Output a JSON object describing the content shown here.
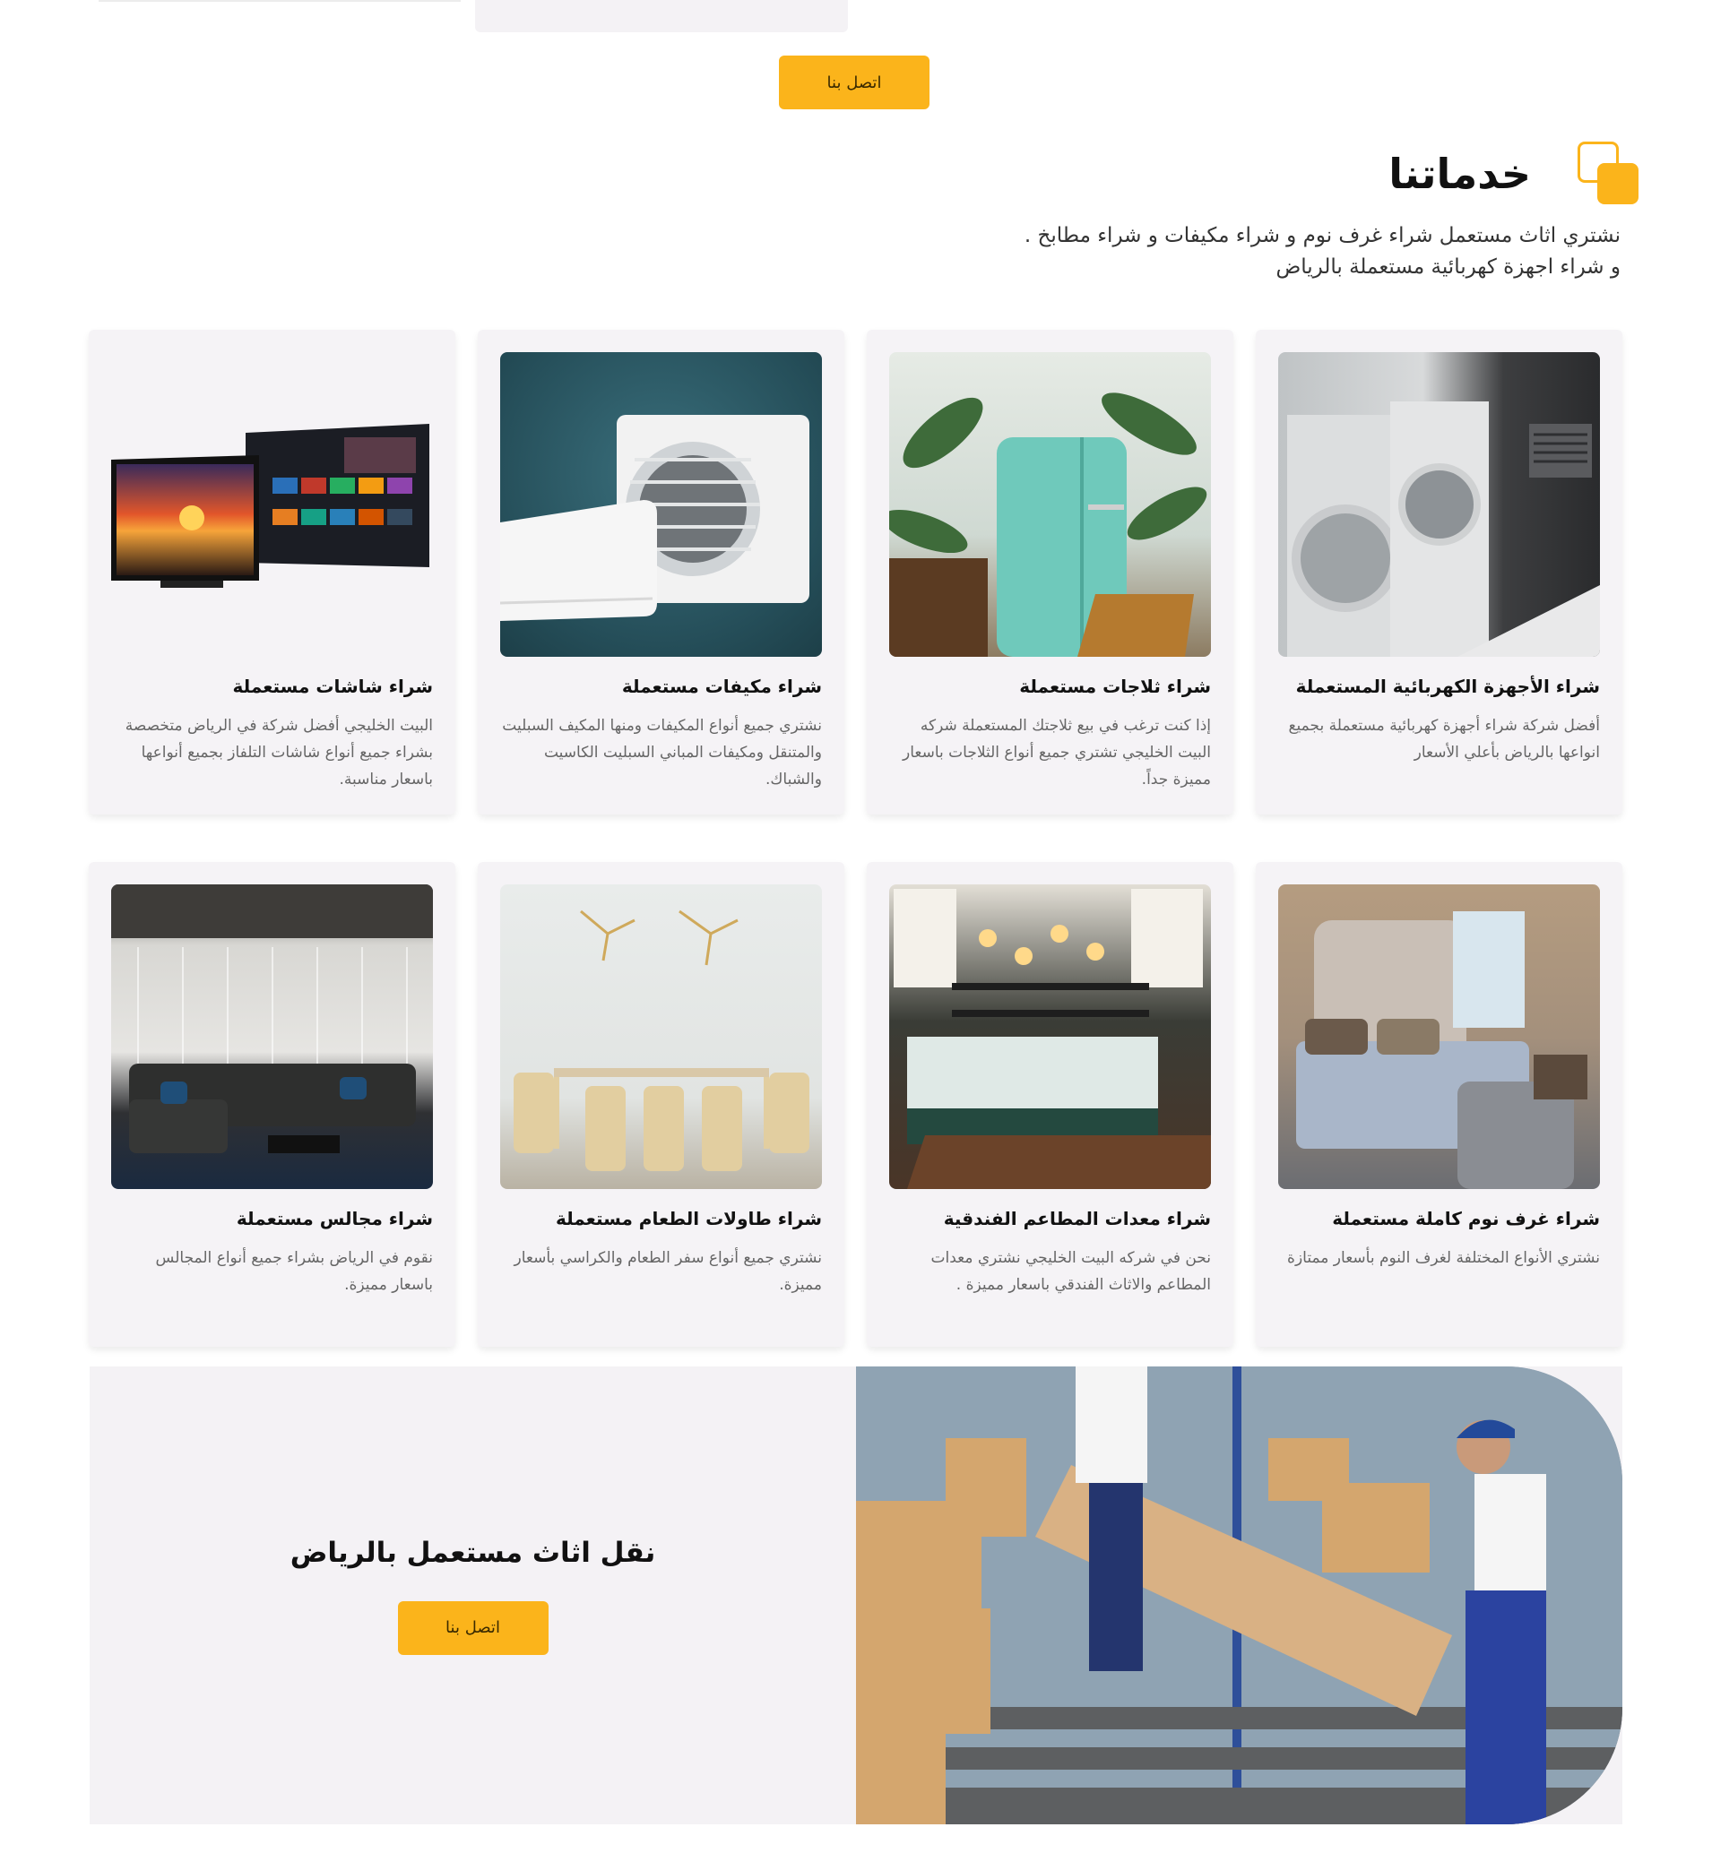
{
  "top": {
    "contact_label": "اتصل بنا"
  },
  "services": {
    "title": "خدماتنا",
    "intro_line1": "نشتري اثاث مستعمل شراء غرف نوم و شراء مكيفات و شراء مطابخ .",
    "intro_line2": "و شراء اجهزة كهربائية مستعملة بالرياض",
    "cards": [
      {
        "title": "شراء الأجهزة الكهربائية المستعملة",
        "desc": "أفضل شركة شراء أجهزة كهربائية مستعملة بجميع انواعها بالرياض بأعلي الأسعار"
      },
      {
        "title": "شراء ثلاجات مستعملة",
        "desc": "إذا كنت ترغب في بيع ثلاجتك المستعملة شركه البيت الخليجي تشتري جميع أنواع الثلاجات باسعار مميزة جداً."
      },
      {
        "title": "شراء مكيفات مستعملة",
        "desc": "نشتري جميع أنواع المكيفات ومنها المكيف السبليت والمتنقل ومكيفات المباني السبليت الكاسيت والشباك."
      },
      {
        "title": "شراء شاشات مستعملة",
        "desc": "البيت الخليجي أفضل شركة في الرياض متخصصة بشراء جميع أنواع شاشات التلفاز بجميع أنواعها باسعار مناسبة."
      },
      {
        "title": "شراء غرف نوم كاملة مستعملة",
        "desc": "نشتري الأنواع المختلفة لغرف النوم بأسعار ممتازة"
      },
      {
        "title": "شراء معدات المطاعم الفندقية",
        "desc": "نحن في شركه البيت الخليجي نشتري معدات المطاعم والاثاث الفندقي باسعار مميزة ."
      },
      {
        "title": "شراء طاولات الطعام مستعملة",
        "desc": "نشتري جميع أنواع سفر الطعام والكراسي بأسعار مميزة."
      },
      {
        "title": "شراء مجالس مستعملة",
        "desc": "نقوم في الرياض بشراء جميع أنواع المجالس باسعار مميزة."
      }
    ]
  },
  "banner": {
    "title": "نقل اثاث مستعمل بالرياض",
    "contact_label": "اتصل بنا"
  },
  "colors": {
    "accent": "#fbb41b",
    "card_bg": "#f5f3f6"
  }
}
